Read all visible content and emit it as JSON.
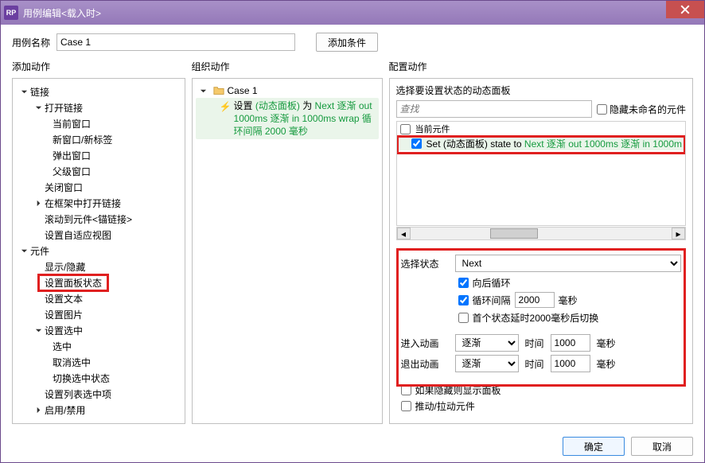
{
  "window": {
    "title": "用例编辑<载入时>"
  },
  "case": {
    "label": "用例名称",
    "value": "Case 1",
    "add_condition": "添加条件"
  },
  "columns": {
    "add_action": "添加动作",
    "organize": "组织动作",
    "configure": "配置动作"
  },
  "tree": {
    "links": "链接",
    "open_link": "打开链接",
    "current_window": "当前窗口",
    "new_window": "新窗口/新标签",
    "popup_window": "弹出窗口",
    "parent_window": "父级窗口",
    "close_window": "关闭窗口",
    "open_in_frame": "在框架中打开链接",
    "scroll_to": "滚动到元件<锚链接>",
    "set_adaptive": "设置自适应视图",
    "widgets": "元件",
    "show_hide": "显示/隐藏",
    "set_panel_state": "设置面板状态",
    "set_text": "设置文本",
    "set_image": "设置图片",
    "set_selected": "设置选中",
    "selected": "选中",
    "unselected": "取消选中",
    "toggle_selected": "切换选中状态",
    "set_list_option": "设置列表选中项",
    "enable_disable": "启用/禁用"
  },
  "organize": {
    "case_name": "Case 1",
    "action_prefix": "设置 ",
    "action_target": "(动态面板)",
    "action_mid": " 为 ",
    "action_green1": "Next 逐渐 out 1000ms 逐渐 in 1000ms wrap 循环间隔 2000 毫秒"
  },
  "config": {
    "select_panel_label": "选择要设置状态的动态面板",
    "search_placeholder": "查找",
    "hide_unnamed": "隐藏未命名的元件",
    "current_widget": "当前元件",
    "set_row_prefix": "Set (动态面板) state to ",
    "set_row_green": "Next 逐渐 out 1000ms 逐渐 in 1000m",
    "select_state": "选择状态",
    "state_value": "Next",
    "loop_back": "向后循环",
    "loop_interval": "循环间隔",
    "interval_value": "2000",
    "ms": "毫秒",
    "first_state_delay": "首个状态延时2000毫秒后切换",
    "enter_anim": "进入动画",
    "exit_anim": "退出动画",
    "anim_type": "逐渐",
    "time_label": "时间",
    "time_value": "1000",
    "show_if_hidden": "如果隐藏则显示面板",
    "push_pull": "推动/拉动元件"
  },
  "footer": {
    "ok": "确定",
    "cancel": "取消"
  }
}
